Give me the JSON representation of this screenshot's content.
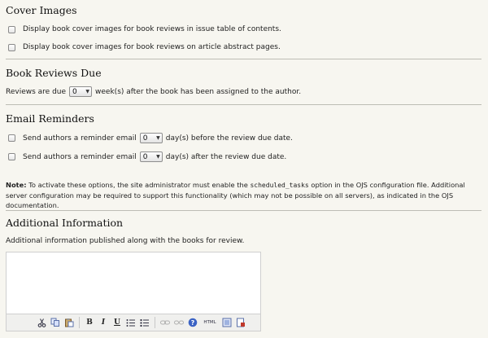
{
  "cover_images": {
    "title": "Cover Images",
    "options": [
      {
        "label": "Display book cover images for book reviews in issue table of contents."
      },
      {
        "label": "Display book cover images for book reviews on article abstract pages."
      }
    ]
  },
  "book_reviews_due": {
    "title": "Book Reviews Due",
    "prefix": "Reviews are due",
    "value": "0",
    "suffix": "week(s) after the book has been assigned to the author."
  },
  "email_reminders": {
    "title": "Email Reminders",
    "before": {
      "prefix": "Send authors a reminder email",
      "value": "0",
      "suffix": "day(s) before the review due date."
    },
    "after": {
      "prefix": "Send authors a reminder email",
      "value": "0",
      "suffix": "day(s) after the review due date."
    }
  },
  "note": {
    "label": "Note:",
    "text_1": "To activate these options, the site administrator must enable the",
    "code": "scheduled_tasks",
    "text_2": "option in the OJS configuration file. Additional server configuration may be required to support this functionality (which may not be possible on all servers), as indicated in the OJS documentation."
  },
  "additional_information": {
    "title": "Additional Information",
    "description": "Additional information published along with the books for review.",
    "editor_value": ""
  },
  "toolbar": {
    "bold": "B",
    "italic": "I",
    "underline": "U",
    "html": "HTML"
  }
}
